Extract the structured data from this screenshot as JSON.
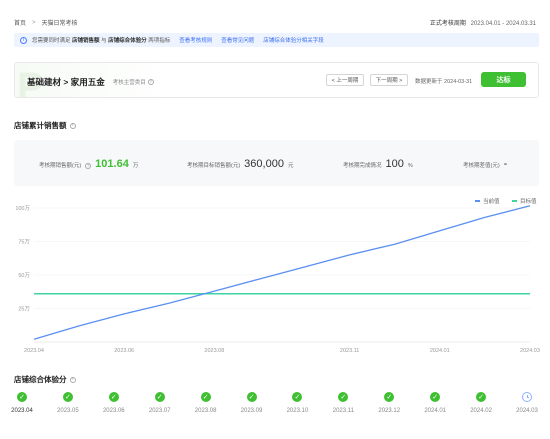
{
  "breadcrumb": {
    "home": "首页",
    "sep": ">",
    "current": "天猫日常考核"
  },
  "period": {
    "label": "正式考核周期",
    "value": "2023.04.01 - 2024.03.31"
  },
  "notice": {
    "text_prefix": "您需要同时满足",
    "bold1": "店铺销售额",
    "mid": "与",
    "bold2": "店铺综合体验分",
    "suffix": "两项指标",
    "link1": "查看考核规则",
    "link2": "查看常见问题",
    "link3": "店铺综合体验分相关字段"
  },
  "category_card": {
    "title": "基础建材 > 家用五金",
    "subtitle": "考核主营类目",
    "prev_label": "< 上一周期",
    "next_label": "下一周期 >",
    "updated": "数据更新于 2024-03-31",
    "status": "达标",
    "status_color": "#3fbf32"
  },
  "sales_section": {
    "title": "店铺累计销售额",
    "stats": [
      {
        "label": "考核期销售额(元)",
        "value": "101.64",
        "unit": "万"
      },
      {
        "label": "考核期目标销售额(元)",
        "value": "360,000",
        "unit": "元"
      },
      {
        "label": "考核期完成情况",
        "value": "100",
        "unit": "%"
      },
      {
        "label": "考核期差值(元)",
        "value": "-",
        "unit": ""
      }
    ]
  },
  "chart_data": {
    "type": "line",
    "legend": [
      "当前值",
      "目标值"
    ],
    "y_ticks": [
      "100万",
      "75万",
      "50万",
      "25万"
    ],
    "x_ticks": [
      "2023.04",
      "2023.06",
      "2023.08",
      "2023.11",
      "2024.01",
      "2024.03"
    ],
    "ylim": [
      0,
      1000000
    ],
    "series": [
      {
        "name": "当前值",
        "color": "#5b8ff0",
        "values": [
          [
            "2023.04",
            20000
          ],
          [
            "2023.05",
            120000
          ],
          [
            "2023.06",
            210000
          ],
          [
            "2023.07",
            290000
          ],
          [
            "2023.08",
            380000
          ],
          [
            "2023.09",
            470000
          ],
          [
            "2023.10",
            560000
          ],
          [
            "2023.11",
            650000
          ],
          [
            "2023.12",
            730000
          ],
          [
            "2024.01",
            830000
          ],
          [
            "2024.02",
            930000
          ],
          [
            "2024.03",
            1016400
          ]
        ]
      },
      {
        "name": "目标值",
        "color": "#3ed3a0",
        "value": 360000
      }
    ]
  },
  "experience_section": {
    "title": "店铺综合体验分",
    "months": [
      {
        "label": "2023.04",
        "status": "pass"
      },
      {
        "label": "2023.05",
        "status": "pass"
      },
      {
        "label": "2023.06",
        "status": "pass"
      },
      {
        "label": "2023.07",
        "status": "pass"
      },
      {
        "label": "2023.08",
        "status": "pass"
      },
      {
        "label": "2023.09",
        "status": "pass"
      },
      {
        "label": "2023.10",
        "status": "pass"
      },
      {
        "label": "2023.11",
        "status": "pass"
      },
      {
        "label": "2023.12",
        "status": "pass"
      },
      {
        "label": "2024.01",
        "status": "pass"
      },
      {
        "label": "2024.02",
        "status": "pass"
      },
      {
        "label": "2024.03",
        "status": "pending"
      }
    ]
  }
}
